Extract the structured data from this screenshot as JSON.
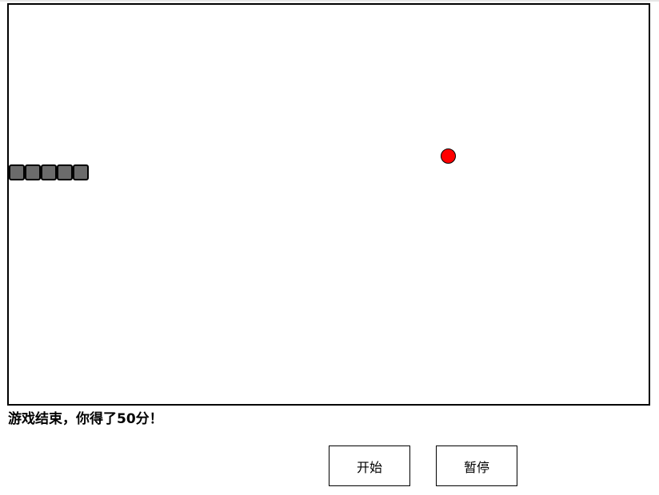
{
  "game": {
    "status_text": "游戏结束，你得了50分！",
    "snake_segments": 5,
    "colors": {
      "snake": "#6b6b6b",
      "food": "#ff0000",
      "board_border": "#000000"
    }
  },
  "controls": {
    "start_label": "开始",
    "pause_label": "暂停"
  }
}
